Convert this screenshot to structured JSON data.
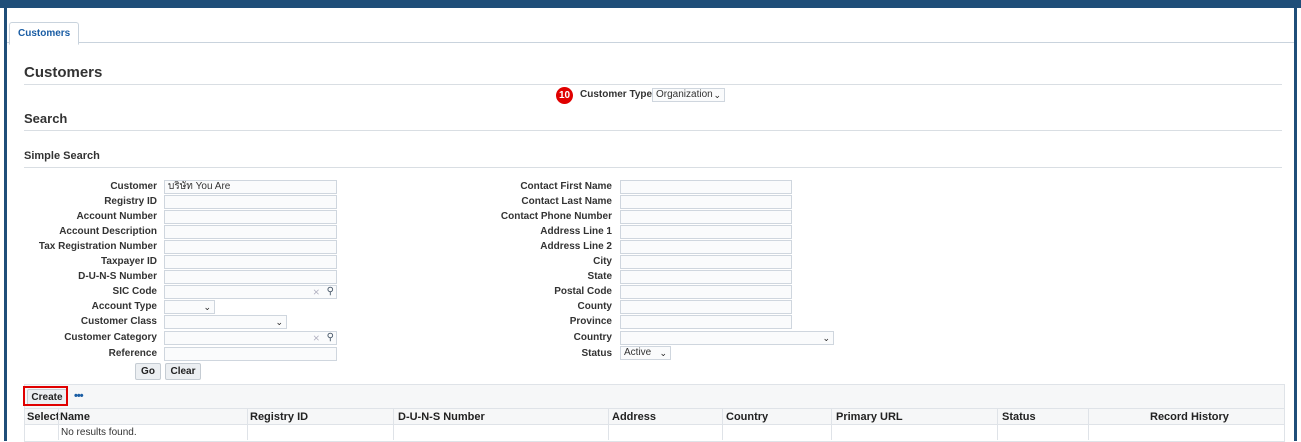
{
  "tab": {
    "label": "Customers"
  },
  "page": {
    "title": "Customers",
    "step_badge": "10",
    "customer_type_label": "Customer Type",
    "customer_type_value": "Organization"
  },
  "search": {
    "title": "Search",
    "subtitle": "Simple Search",
    "left_fields": [
      {
        "label": "Customer",
        "value": "บริษัท You Are"
      },
      {
        "label": "Registry ID",
        "value": ""
      },
      {
        "label": "Account Number",
        "value": ""
      },
      {
        "label": "Account Description",
        "value": ""
      },
      {
        "label": "Tax Registration Number",
        "value": ""
      },
      {
        "label": "Taxpayer ID",
        "value": ""
      },
      {
        "label": "D-U-N-S Number",
        "value": ""
      },
      {
        "label": "SIC Code",
        "value": ""
      },
      {
        "label": "Account Type",
        "value": ""
      },
      {
        "label": "Customer Class",
        "value": ""
      },
      {
        "label": "Customer Category",
        "value": ""
      },
      {
        "label": "Reference",
        "value": ""
      }
    ],
    "right_fields": [
      {
        "label": "Contact First Name",
        "value": ""
      },
      {
        "label": "Contact Last Name",
        "value": ""
      },
      {
        "label": "Contact Phone Number",
        "value": ""
      },
      {
        "label": "Address Line 1",
        "value": ""
      },
      {
        "label": "Address Line 2",
        "value": ""
      },
      {
        "label": "City",
        "value": ""
      },
      {
        "label": "State",
        "value": ""
      },
      {
        "label": "Postal Code",
        "value": ""
      },
      {
        "label": "County",
        "value": ""
      },
      {
        "label": "Province",
        "value": ""
      },
      {
        "label": "Country",
        "value": ""
      },
      {
        "label": "Status",
        "value": "Active"
      }
    ],
    "go_label": "Go",
    "clear_label": "Clear"
  },
  "results": {
    "create_label": "Create",
    "more_label": "•••",
    "columns": [
      "Select",
      "Name",
      "Registry ID",
      "D-U-N-S Number",
      "Address",
      "Country",
      "Primary URL",
      "Status",
      "Record History"
    ],
    "empty_message": "No results found."
  },
  "colors": {
    "accent": "#1f4e79",
    "highlight_box": "#e00000"
  }
}
